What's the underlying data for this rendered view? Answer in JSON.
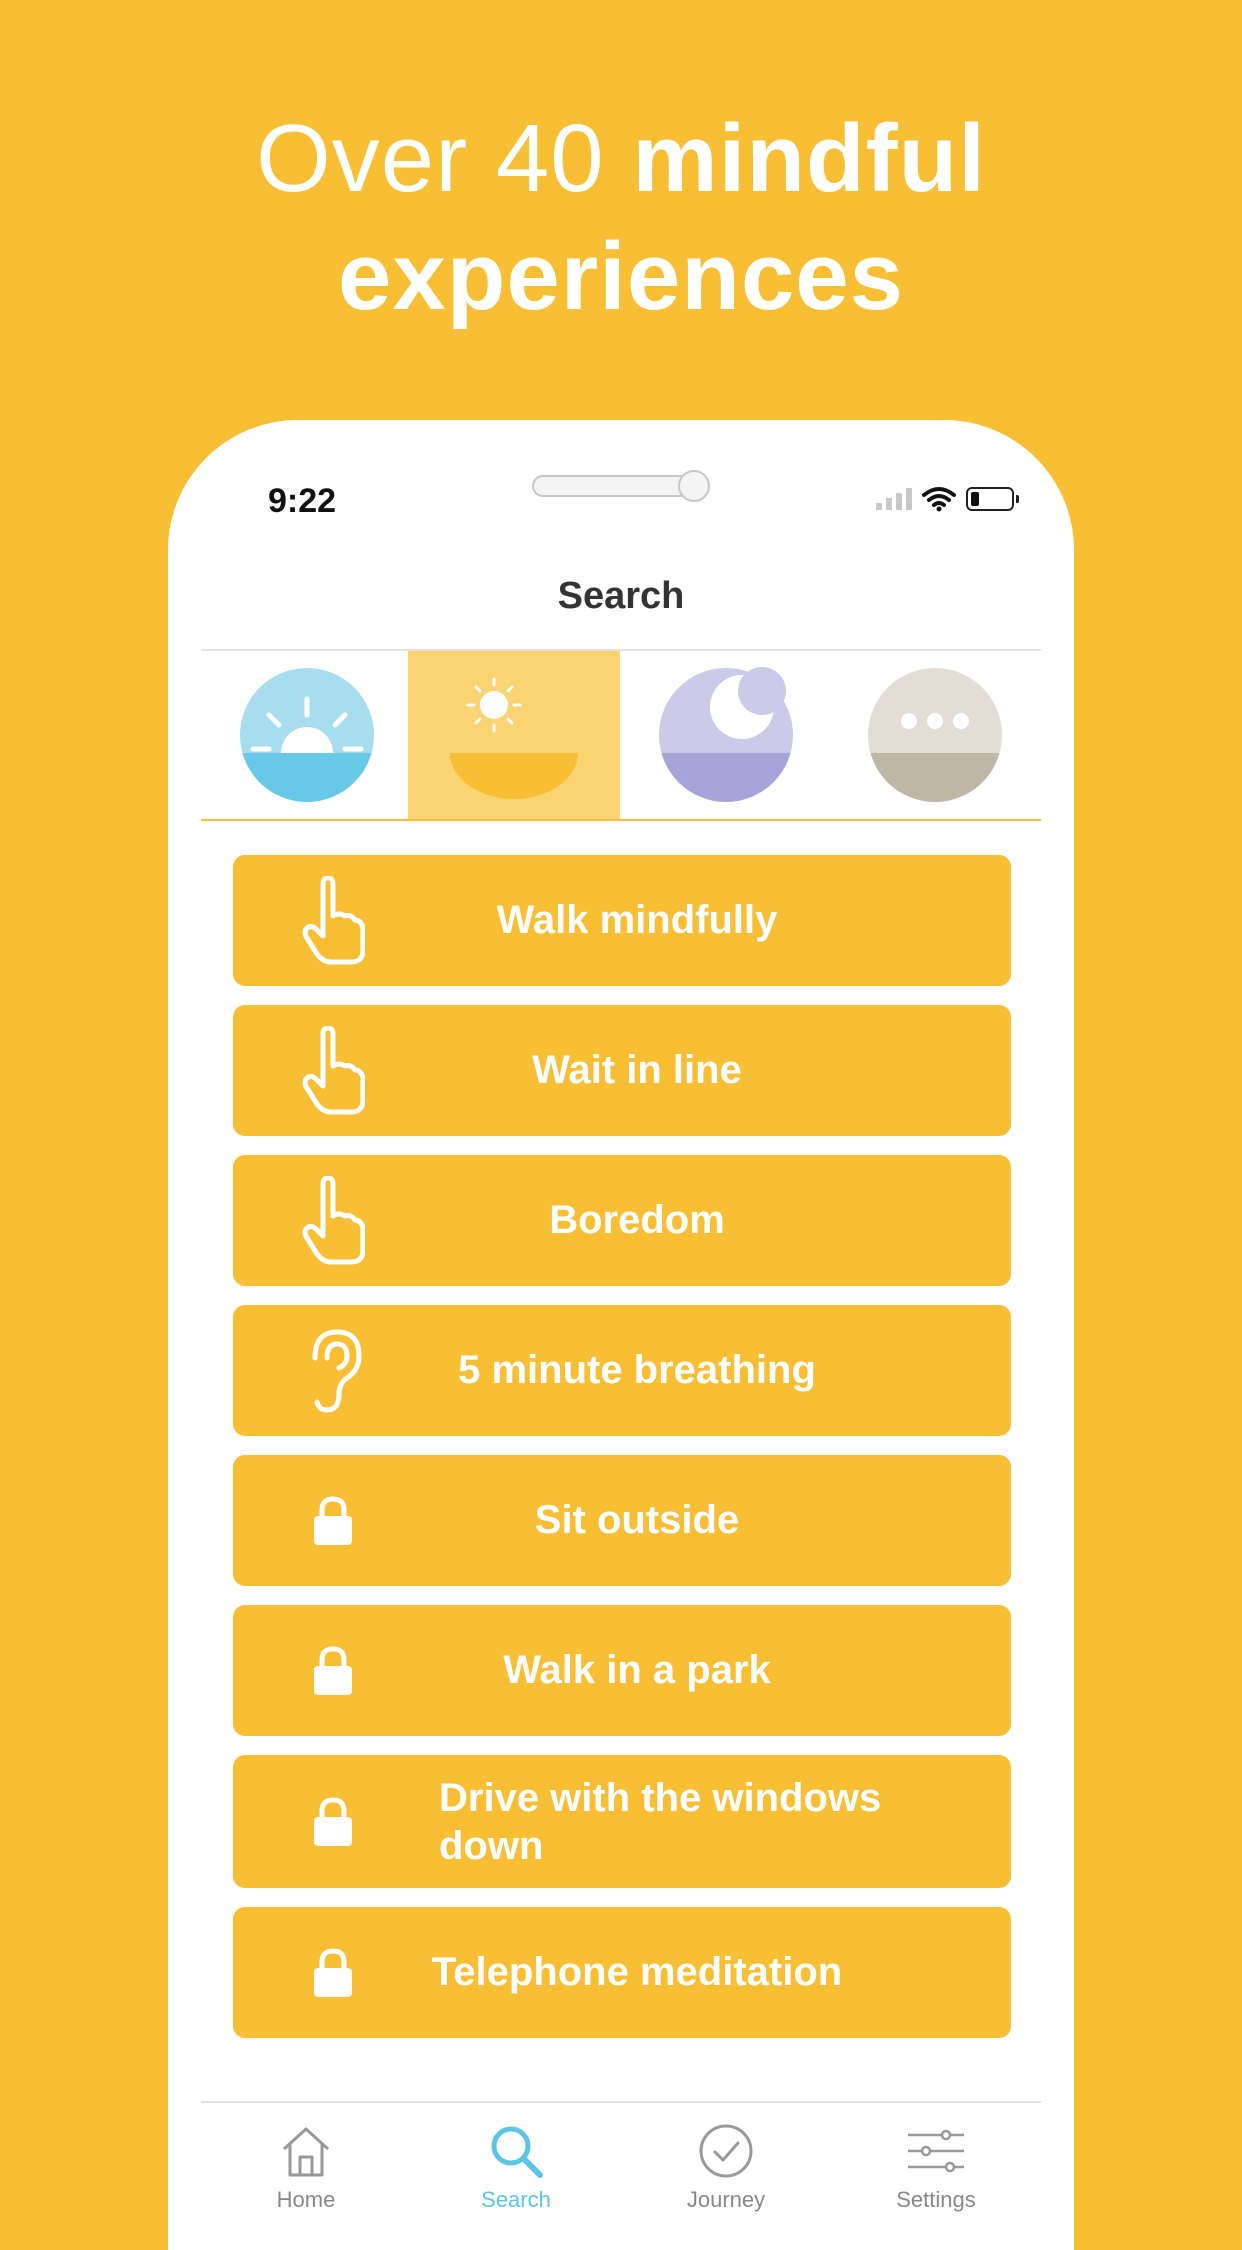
{
  "headline": {
    "light": "Over 40 ",
    "bold": "mindful experiences"
  },
  "status": {
    "time": "9:22"
  },
  "nav": {
    "title": "Search"
  },
  "categories": [
    {
      "name": "morning",
      "icon": "sunrise-icon",
      "color": "#67C8E8",
      "active": false
    },
    {
      "name": "day",
      "icon": "sun-icon",
      "color": "#F8BE34",
      "active": true
    },
    {
      "name": "night",
      "icon": "moon-icon",
      "color": "#A7A4D9",
      "active": false
    },
    {
      "name": "more",
      "icon": "more-icon",
      "color": "#BFB6A5",
      "active": false
    }
  ],
  "items": [
    {
      "label": "Walk mindfully",
      "icon": "hand-pointer-icon"
    },
    {
      "label": "Wait in line",
      "icon": "hand-pointer-icon"
    },
    {
      "label": "Boredom",
      "icon": "hand-pointer-icon"
    },
    {
      "label": "5 minute breathing",
      "icon": "ear-icon"
    },
    {
      "label": "Sit outside",
      "icon": "lock-icon"
    },
    {
      "label": "Walk in a park",
      "icon": "lock-icon"
    },
    {
      "label": "Drive with the windows down",
      "icon": "lock-icon"
    },
    {
      "label": "Telephone meditation",
      "icon": "lock-icon"
    }
  ],
  "tabs": [
    {
      "label": "Home",
      "icon": "home-icon"
    },
    {
      "label": "Search",
      "icon": "search-icon",
      "active": true
    },
    {
      "label": "Journey",
      "icon": "check-circle-icon"
    },
    {
      "label": "Settings",
      "icon": "sliders-icon"
    }
  ],
  "colors": {
    "brand": "#F8BE34",
    "active_tab": "#5BC5E6"
  }
}
